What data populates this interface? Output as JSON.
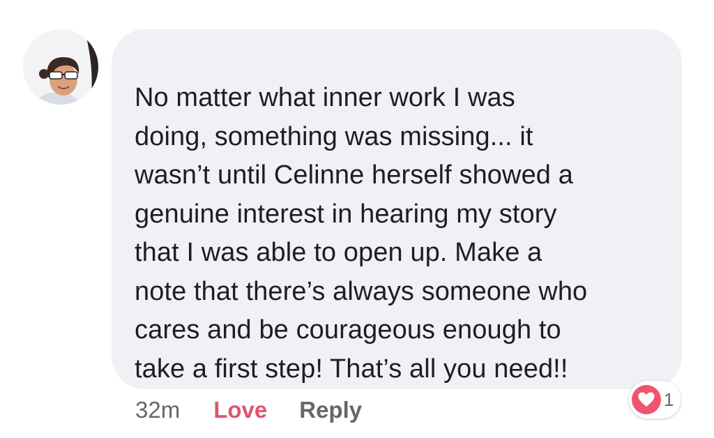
{
  "comment": {
    "text": "No matter what inner work I was\ndoing, something was missing... it\nwasn’t until Celinne herself showed a\ngenuine interest in hearing my story\nthat I was able to open up. Make a\nnote that there’s always someone who\ncares and be courageous enough to\ntake a first step! That’s all you need!!",
    "avatar_icon": "profile-photo",
    "bubble_color": "#f0f1f4"
  },
  "actions": {
    "timestamp": "32m",
    "love_label": "Love",
    "reply_label": "Reply",
    "love_color": "#e0556d"
  },
  "reactions": {
    "icon": "heart-icon",
    "count": "1",
    "icon_color": "#f0556e"
  }
}
